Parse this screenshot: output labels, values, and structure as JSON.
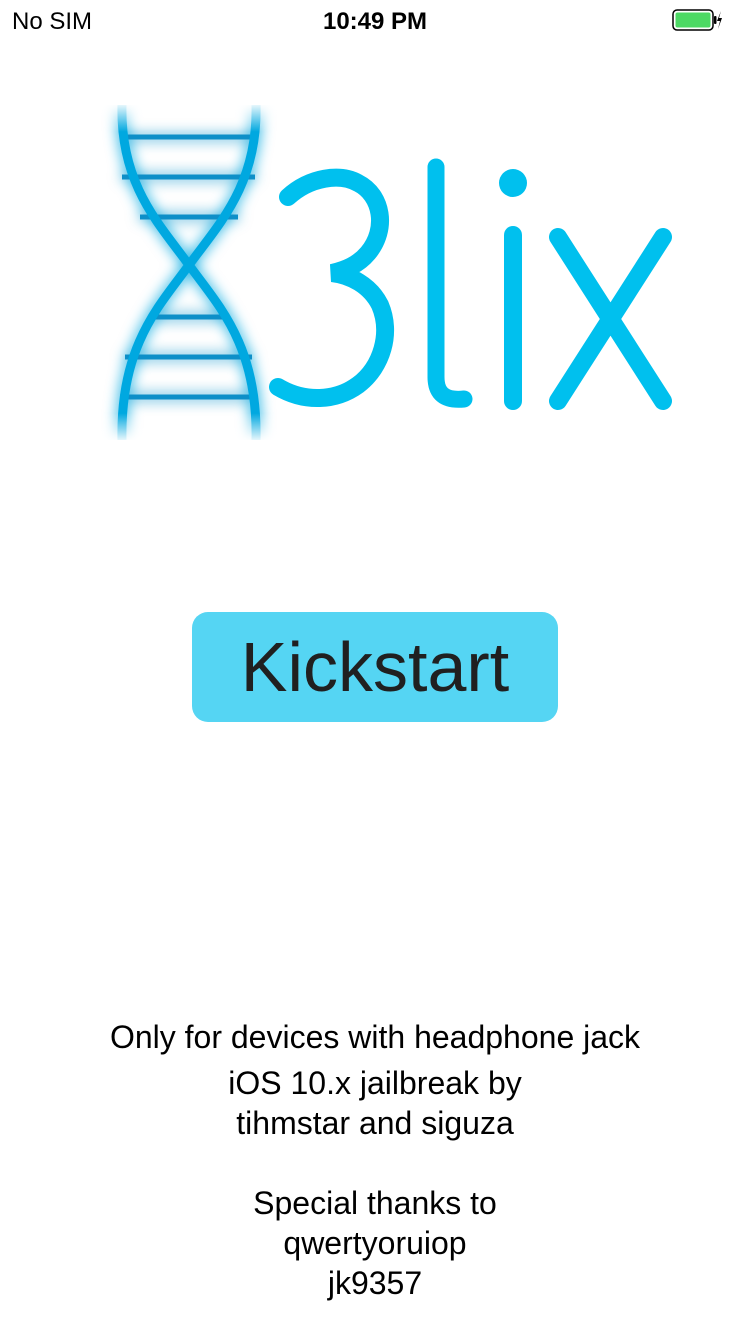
{
  "status_bar": {
    "carrier": "No SIM",
    "time": "10:49 PM",
    "battery_icon": "battery-charging-icon",
    "battery_color": "#4cd964"
  },
  "logo": {
    "text": "3lix",
    "icon": "dna-helix-icon",
    "color": "#00c0ee"
  },
  "kickstart_button": {
    "label": "Kickstart",
    "color": "#55d5f3"
  },
  "footer": {
    "warning": "Only for devices with headphone jack",
    "credit_line1": "iOS 10.x jailbreak by",
    "credit_line2": "tihmstar and siguza",
    "thanks_title": "Special thanks to",
    "thanks_1": "qwertyoruiop",
    "thanks_2": "jk9357"
  }
}
